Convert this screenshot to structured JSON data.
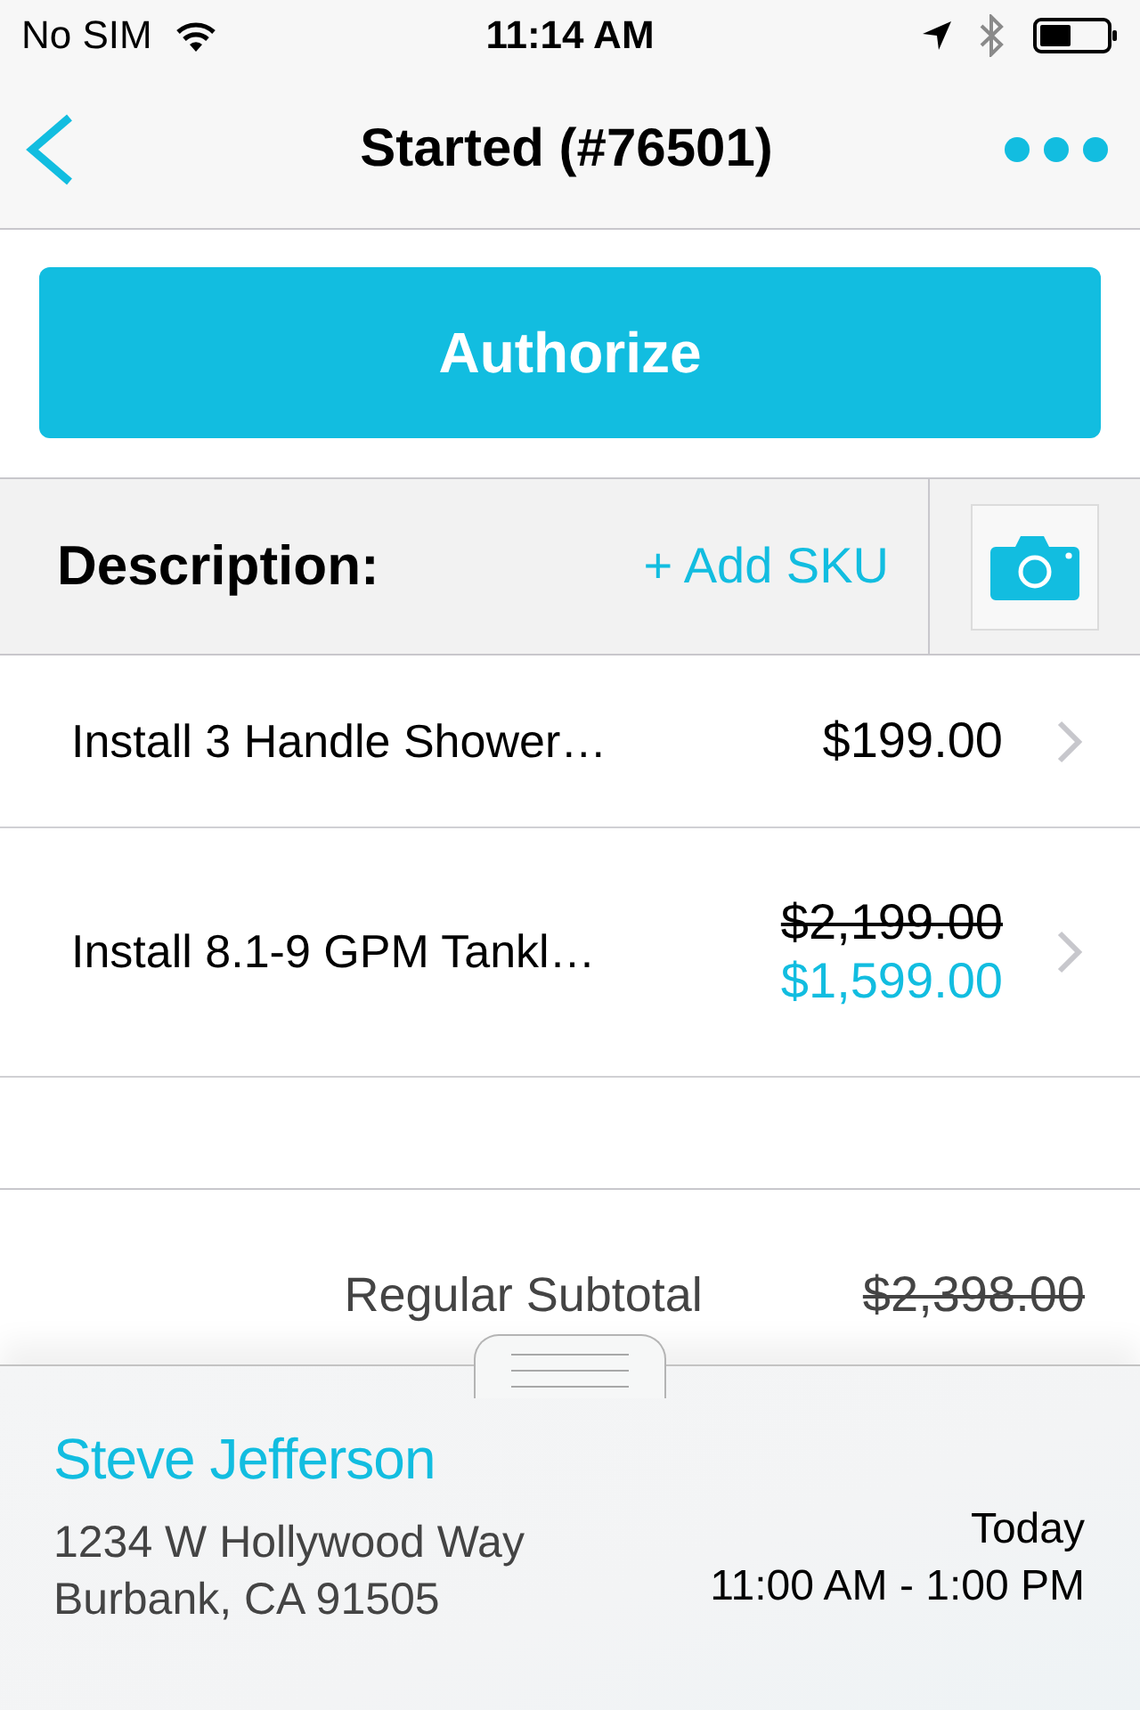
{
  "status_bar": {
    "carrier": "No SIM",
    "time": "11:14 AM"
  },
  "nav": {
    "title": "Started (#76501)"
  },
  "authorize_button": {
    "label": "Authorize"
  },
  "description_bar": {
    "label": "Description:",
    "add_sku": "+ Add SKU"
  },
  "line_items": [
    {
      "name": "Install 3 Handle Shower…",
      "prices": [
        {
          "amount": "$199.00",
          "kind": "regular"
        }
      ]
    },
    {
      "name": "Install 8.1-9 GPM Tankl…",
      "prices": [
        {
          "amount": "$2,199.00",
          "kind": "original"
        },
        {
          "amount": "$1,599.00",
          "kind": "sale"
        }
      ]
    }
  ],
  "summary": [
    {
      "label": "Regular Subtotal",
      "amount": "$2,398.00",
      "kind": "original"
    }
  ],
  "customer": {
    "name": "Steve Jefferson",
    "address_lines": [
      "1234 W Hollywood Way",
      "Burbank, CA 91505"
    ],
    "date": "Today",
    "time_window": "11:00 AM - 1:00 PM"
  }
}
